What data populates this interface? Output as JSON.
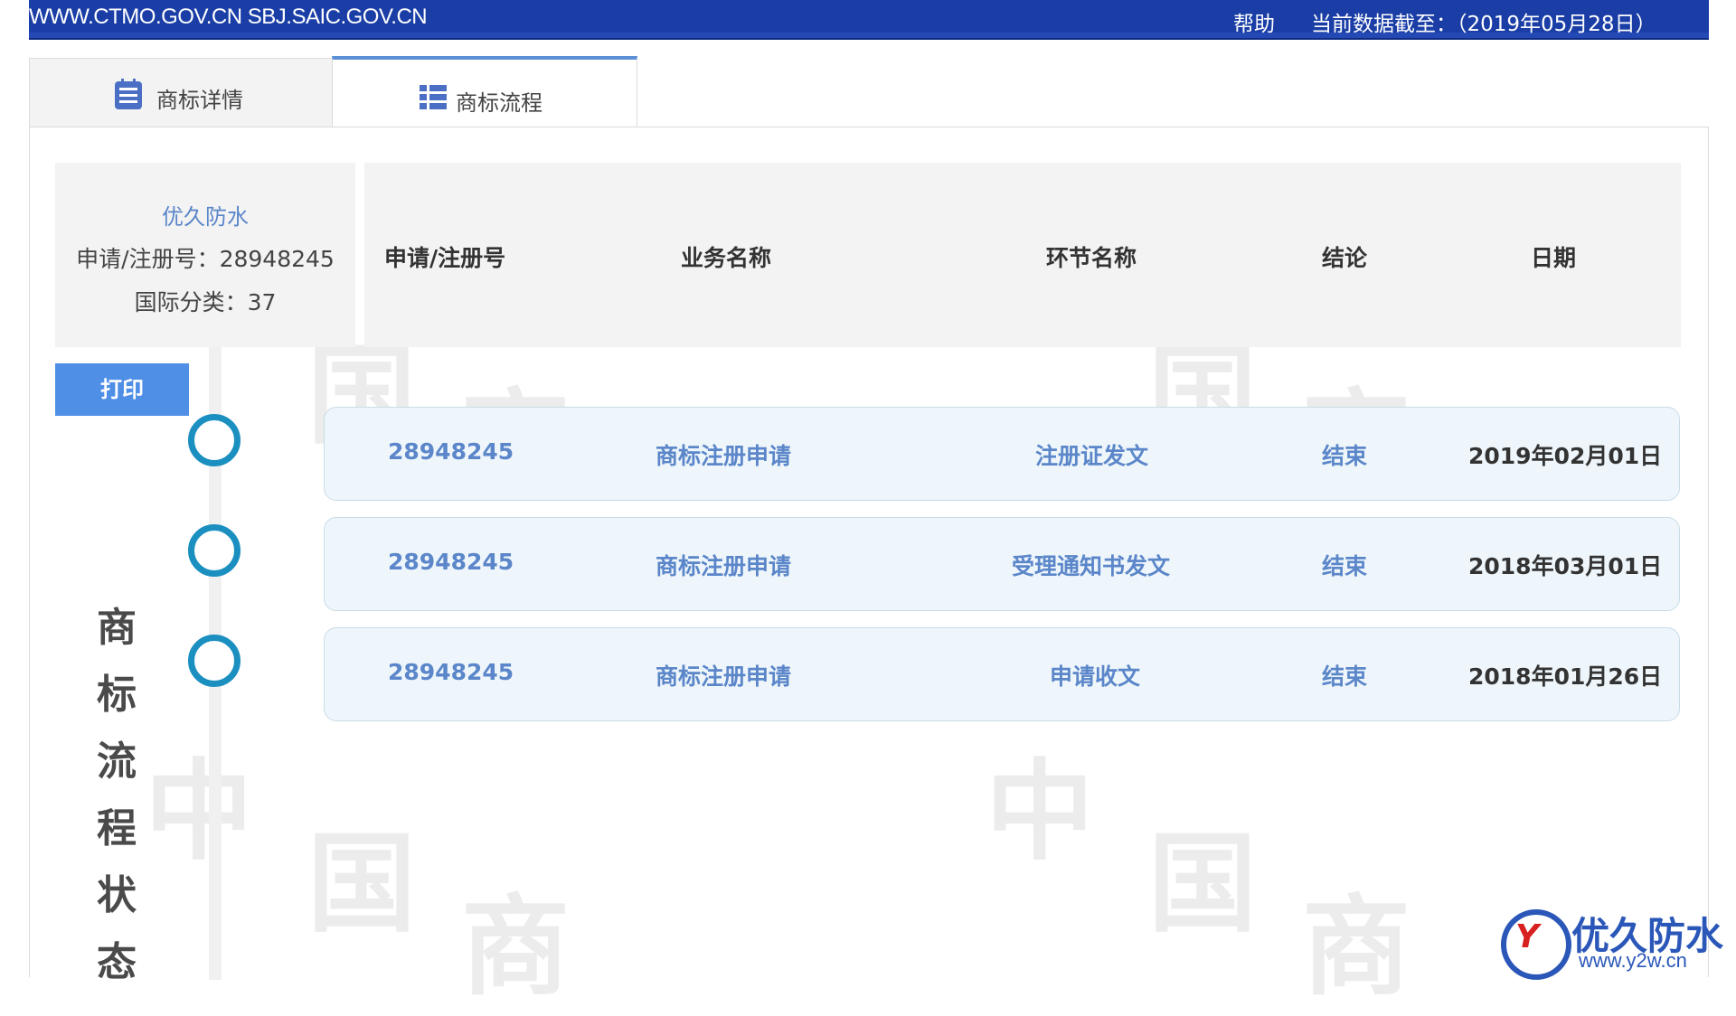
{
  "topbar": {
    "site": "WWW.CTMO.GOV.CN SBJ.SAIC.GOV.CN",
    "help": "帮助",
    "data_date": "当前数据截至：（2019年05月28日）"
  },
  "tabs": [
    {
      "label": "商标详情",
      "icon": "list-doc-icon"
    },
    {
      "label": "商标流程",
      "icon": "list-icon",
      "active": true
    }
  ],
  "info": {
    "name": "优久防水",
    "reg_no": "申请/注册号：28948245",
    "intl_class": "国际分类：37"
  },
  "print_label": "打印",
  "side_title": [
    "商",
    "标",
    "流",
    "程",
    "状",
    "态"
  ],
  "columns": [
    "申请/注册号",
    "业务名称",
    "环节名称",
    "结论",
    "日期"
  ],
  "rows": [
    {
      "reg_no": "28948245",
      "business": "商标注册申请",
      "step": "注册证发文",
      "result": "结束",
      "date": "2019年02月01日"
    },
    {
      "reg_no": "28948245",
      "business": "商标注册申请",
      "step": "受理通知书发文",
      "result": "结束",
      "date": "2018年03月01日"
    },
    {
      "reg_no": "28948245",
      "business": "商标注册申请",
      "step": "申请收文",
      "result": "结束",
      "date": "2018年01月26日"
    }
  ],
  "logo": {
    "mark": "Y",
    "brand": "优久防水",
    "url": "www.y2w.cn"
  },
  "colors": {
    "topbar": "#1a3ea6",
    "accent": "#4f8fe6",
    "timeline": "#1a8fc0",
    "link": "#5b86c9"
  }
}
